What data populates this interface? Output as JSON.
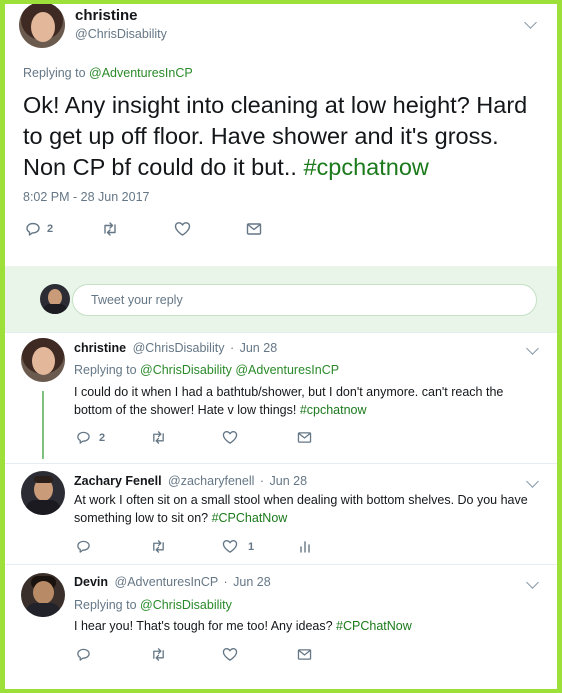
{
  "main_tweet": {
    "name": "christine",
    "handle": "@ChrisDisability",
    "replying_prefix": "Replying to ",
    "replying_to": "@AdventuresInCP",
    "text": "Ok! Any insight into cleaning at low height? Hard to get up off floor. Have shower and it's gross. Non CP bf could do it but.. ",
    "hashtag": "#cpchatnow",
    "timestamp": "8:02 PM - 28 Jun 2017",
    "reply_count": "2"
  },
  "composer": {
    "placeholder": "Tweet your reply"
  },
  "replies": [
    {
      "name": "christine",
      "handle": "@ChrisDisability",
      "dot": "·",
      "date": "Jun 28",
      "replying_prefix": "Replying to ",
      "replying_to": "@ChrisDisability @AdventuresInCP",
      "text": "I could do it when I had a bathtub/shower, but I don't anymore. can't reach the bottom of the shower! Hate v low things! ",
      "hashtag": "#cpchatnow",
      "reply_count": "2"
    },
    {
      "name": "Zachary Fenell",
      "handle": "@zacharyfenell",
      "dot": "·",
      "date": "Jun 28",
      "text": "At work I often sit on a small stool when dealing with bottom shelves. Do you have something low to sit on? ",
      "hashtag": "#CPChatNow",
      "like_count": "1"
    },
    {
      "name": "Devin",
      "handle": "@AdventuresInCP",
      "dot": "·",
      "date": "Jun 28",
      "replying_prefix": "Replying to ",
      "replying_to": "@ChrisDisability",
      "text": "I hear you! That's tough for me too! Any ideas? ",
      "hashtag": "#CPChatNow"
    }
  ],
  "icons": {
    "reply": "reply-icon",
    "retweet": "retweet-icon",
    "like": "heart-icon",
    "dm": "envelope-icon",
    "analytics": "analytics-icon",
    "more": "chevron-down-icon"
  },
  "colors": {
    "border": "#9de03a",
    "hashtag": "#1b7a1b",
    "composer_bg": "#e8f5e8"
  }
}
